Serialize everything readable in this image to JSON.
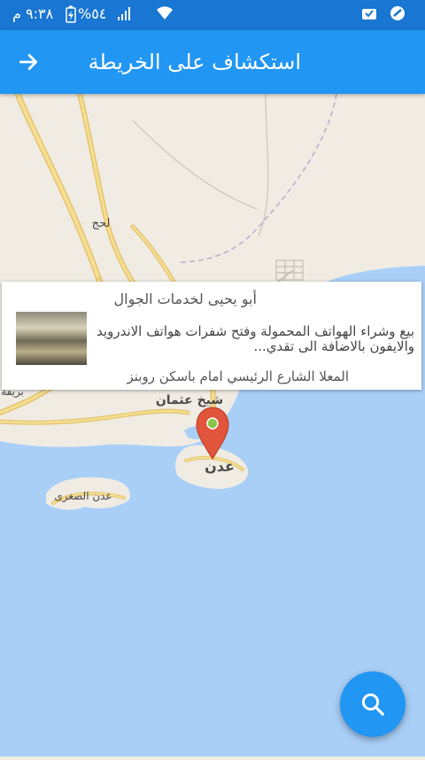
{
  "status_bar": {
    "time": "٩:٣٨ م",
    "battery": "%٥٤",
    "icons": [
      "battery-charging-icon",
      "signal-icon",
      "wifi-icon",
      "notification-icon",
      "app-icon"
    ]
  },
  "header": {
    "title": "استكشاف على الخريطة",
    "back_icon": "arrow-icon"
  },
  "map": {
    "labels": {
      "lahj": "لحج",
      "sheikh_othman": "شيخ عثمان",
      "aden": "عدن",
      "little_aden": "عدن الصغرى",
      "buraiqa": "بريقة"
    },
    "colors": {
      "land": "#f0ece4",
      "water": "#a9cff7",
      "road": "#f3d98b",
      "road_edge": "#e3c46c",
      "marker": "#e2543b",
      "marker_dot": "#8bc34a"
    }
  },
  "info_card": {
    "title": "أبو يحيى لخدمات الجوال",
    "description": "بيع وشراء الهواتف المحمولة وفتح شفرات هواتف الاندرويد والايفون بالاضافة الى تقدي...",
    "address": "المعلا الشارع الرئيسي امام باسكن روبنز"
  },
  "fab": {
    "icon": "search-icon",
    "color": "#2196f3"
  }
}
